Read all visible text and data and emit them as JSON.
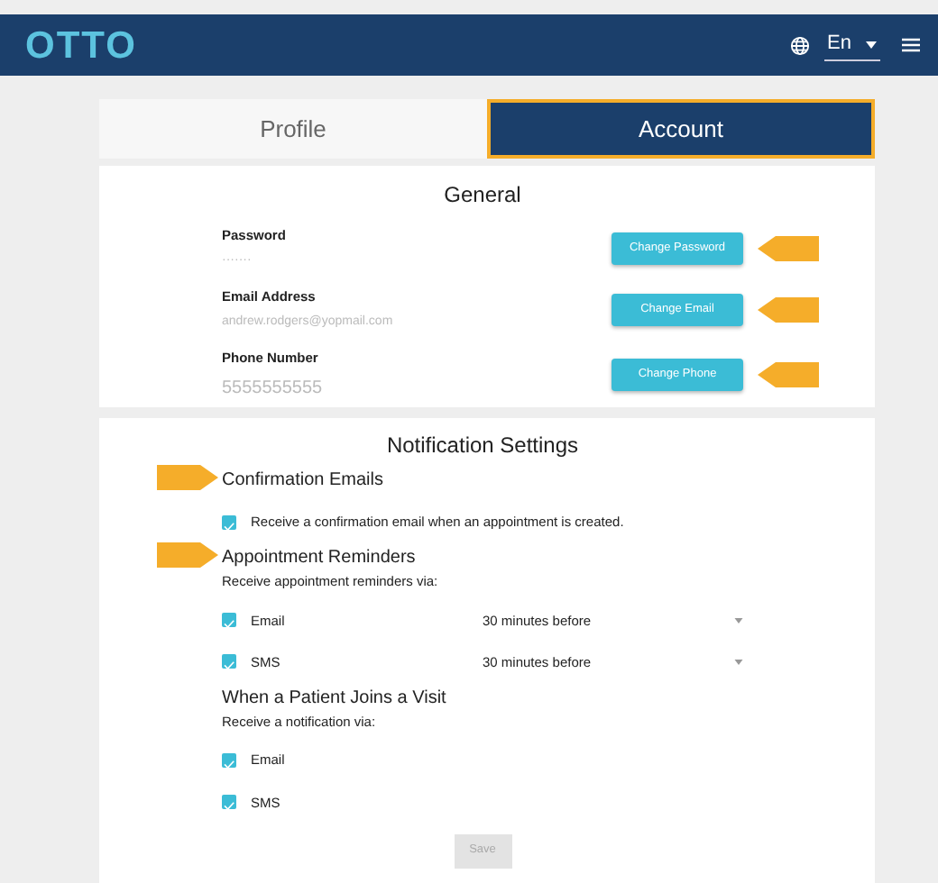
{
  "header": {
    "logo": "OTTO",
    "language": "En"
  },
  "tabs": [
    {
      "label": "Profile",
      "selected": false,
      "highlighted": false
    },
    {
      "label": "Account",
      "selected": true,
      "highlighted": true
    }
  ],
  "general": {
    "title": "General",
    "fields": [
      {
        "label": "Password",
        "value": "·······",
        "button": "Change Password",
        "callout": true
      },
      {
        "label": "Email Address",
        "value": "andrew.rodgers@yopmail.com",
        "button": "Change Email",
        "callout": true
      },
      {
        "label": "Phone Number",
        "value": "5555555555",
        "button": "Change Phone",
        "callout": true
      }
    ]
  },
  "notifications": {
    "title": "Notification Settings",
    "sections": [
      {
        "heading": "Confirmation Emails",
        "callout": true,
        "options": [
          {
            "label": "Receive a confirmation email when an appointment is created.",
            "checked": true
          }
        ]
      },
      {
        "heading": "Appointment Reminders",
        "callout": true,
        "description": "Receive appointment reminders via:",
        "options": [
          {
            "label": "Email",
            "checked": true,
            "timing": "30 minutes before"
          },
          {
            "label": "SMS",
            "checked": true,
            "timing": "30 minutes before"
          }
        ]
      },
      {
        "heading": "When a Patient Joins a Visit",
        "description": "Receive a notification via:",
        "options": [
          {
            "label": "Email",
            "checked": true
          },
          {
            "label": "SMS",
            "checked": true
          }
        ]
      }
    ],
    "save": {
      "label": "Save",
      "disabled": true
    }
  }
}
